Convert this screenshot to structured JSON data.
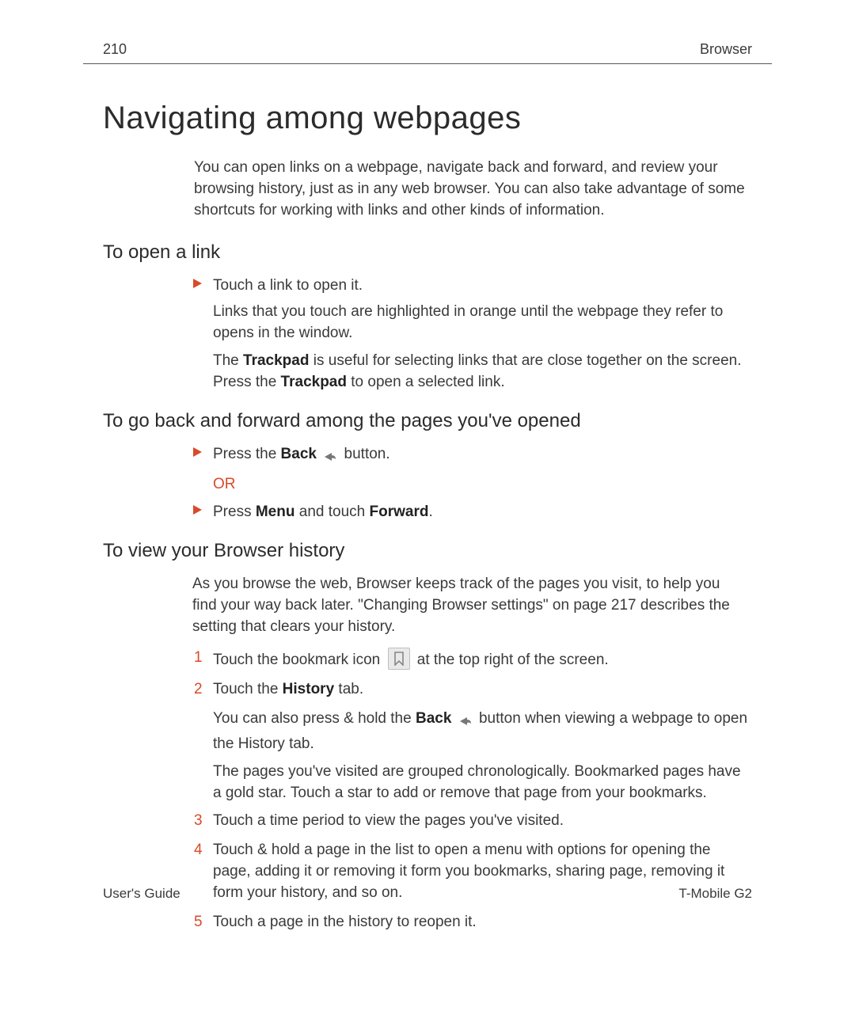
{
  "header": {
    "page_number": "210",
    "section": "Browser"
  },
  "title": "Navigating among webpages",
  "intro": "You can open links on a webpage, navigate back and forward, and review your browsing history, just as in any web browser. You can also take advantage of some shortcuts for working with links and other kinds of information.",
  "s1": {
    "heading": "To open a link",
    "b1": "Touch a link to open it.",
    "p1": "Links that you touch are highlighted in orange until the webpage they refer to opens in the window.",
    "p2a": "The ",
    "p2b": "Trackpad",
    "p2c": " is useful for selecting links that are close together on the screen. Press the ",
    "p2d": "Trackpad",
    "p2e": " to open a selected link."
  },
  "s2": {
    "heading": "To go back and forward among the pages you've opened",
    "b1a": "Press the ",
    "b1b": "Back",
    "b1c": " button.",
    "or": "OR",
    "b2a": "Press ",
    "b2b": "Menu",
    "b2c": " and touch ",
    "b2d": "Forward",
    "b2e": "."
  },
  "s3": {
    "heading": "To view your Browser history",
    "intro": "As you browse the web, Browser keeps track of the pages you visit, to help you find your way back later. \"Changing Browser settings\" on page 217 describes the setting that clears your history.",
    "n1a": "Touch the bookmark icon ",
    "n1b": " at the top right of the screen.",
    "n2a": "Touch the ",
    "n2b": "History",
    "n2c": " tab.",
    "n2p1a": "You can also press & hold the ",
    "n2p1b": "Back",
    "n2p1c": " button when viewing a webpage to open the History tab.",
    "n2p2": "The pages you've visited are grouped chronologically. Bookmarked pages have a gold star. Touch a star to add or remove that page from your bookmarks.",
    "n3": "Touch a time period to view the pages you've visited.",
    "n4": "Touch & hold a page in the list to open a menu with options for opening the page, adding it or removing it form you bookmarks, sharing page, removing it form your history, and so on.",
    "n5": "Touch a page in the history to reopen it."
  },
  "nums": {
    "1": "1",
    "2": "2",
    "3": "3",
    "4": "4",
    "5": "5"
  },
  "footer": {
    "left": "User's Guide",
    "right": "T-Mobile G2"
  },
  "colors": {
    "accent": "#d94a2a"
  }
}
